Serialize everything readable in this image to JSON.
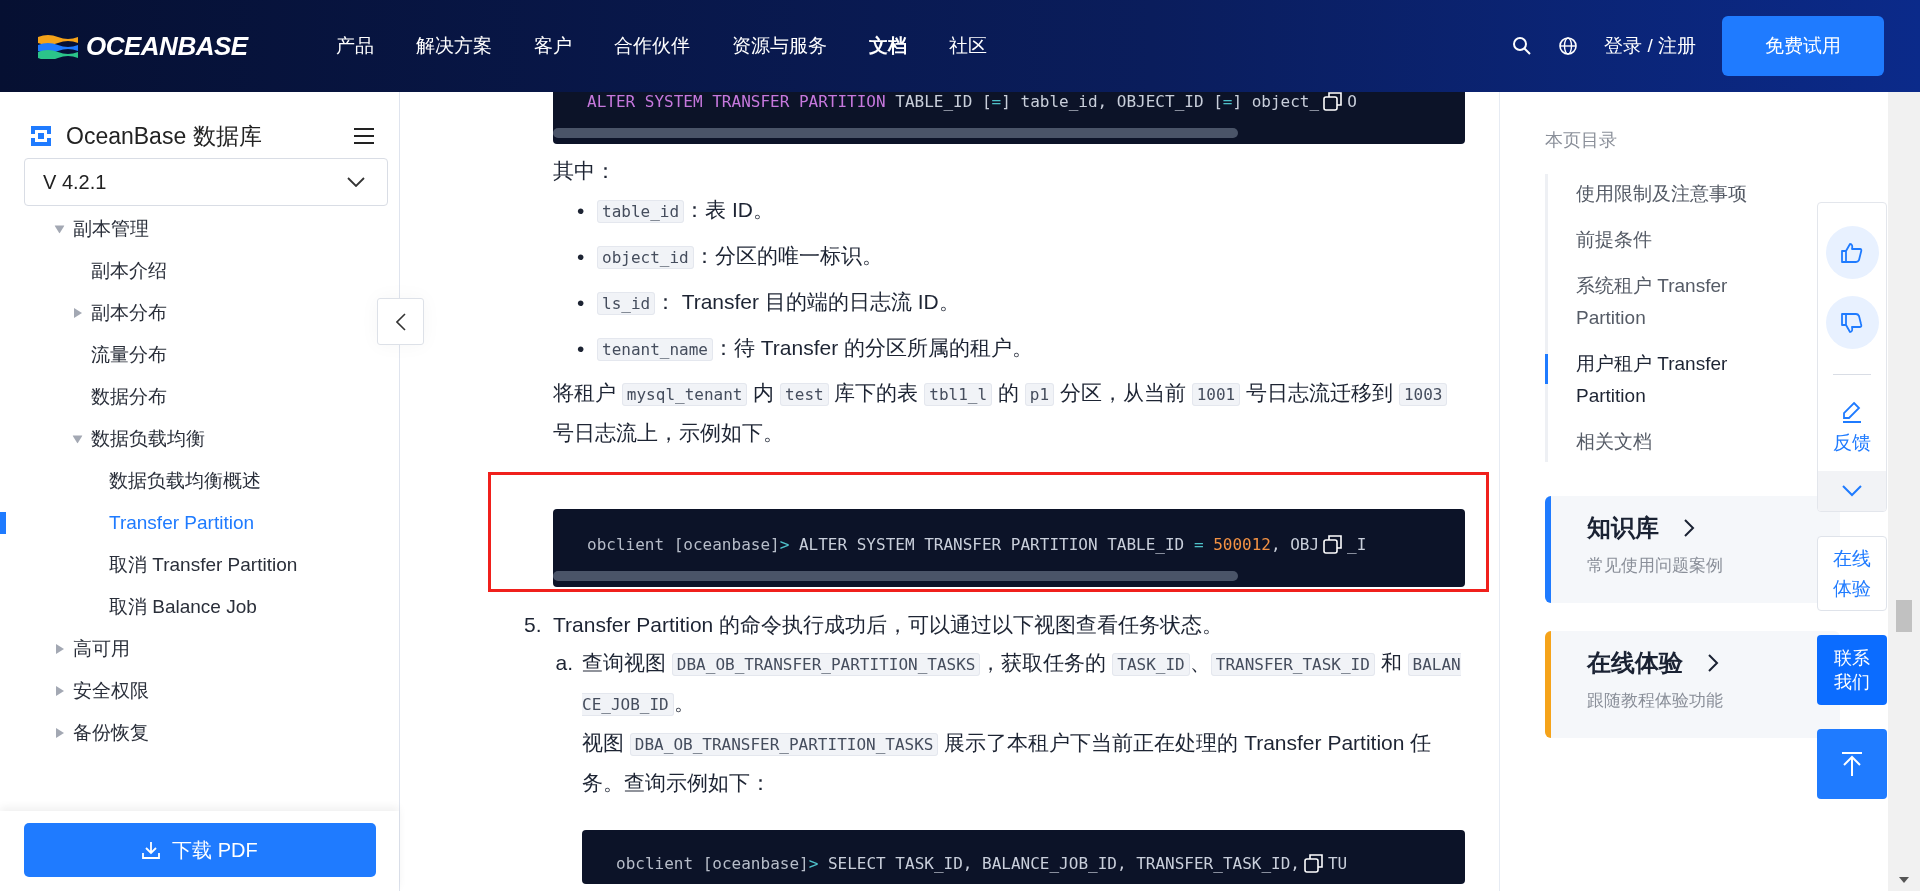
{
  "header": {
    "logo_text": "OCEANBASE",
    "nav": [
      {
        "label": "产品",
        "selected": false
      },
      {
        "label": "解决方案",
        "selected": false
      },
      {
        "label": "客户",
        "selected": false
      },
      {
        "label": "合作伙伴",
        "selected": false
      },
      {
        "label": "资源与服务",
        "selected": false
      },
      {
        "label": "文档",
        "selected": true
      },
      {
        "label": "社区",
        "selected": false
      }
    ],
    "login": "登录 / 注册",
    "cta": "免费试用"
  },
  "sidebar": {
    "title": "OceanBase 数据库",
    "version": "V 4.2.1",
    "download": "下载 PDF",
    "tree": [
      {
        "label": "副本管理",
        "kind": "folder",
        "expanded": true,
        "selected": false,
        "children": [
          {
            "label": "副本介绍",
            "kind": "leaf",
            "selected": false
          },
          {
            "label": "副本分布",
            "kind": "folder",
            "expanded": false,
            "selected": false
          },
          {
            "label": "流量分布",
            "kind": "leaf",
            "selected": false
          },
          {
            "label": "数据分布",
            "kind": "leaf",
            "selected": false
          },
          {
            "label": "数据负载均衡",
            "kind": "folder",
            "expanded": true,
            "selected": false,
            "children": [
              {
                "label": "数据负载均衡概述",
                "kind": "leaf",
                "selected": false
              },
              {
                "label": "Transfer Partition",
                "kind": "leaf",
                "selected": true
              },
              {
                "label": "取消 Transfer Partition",
                "kind": "leaf",
                "selected": false
              },
              {
                "label": "取消 Balance Job",
                "kind": "leaf",
                "selected": false
              }
            ]
          }
        ]
      },
      {
        "label": "高可用",
        "kind": "folder",
        "expanded": false,
        "selected": false
      },
      {
        "label": "安全权限",
        "kind": "folder",
        "expanded": false,
        "selected": false
      },
      {
        "label": "备份恢复",
        "kind": "folder",
        "expanded": false,
        "selected": false
      }
    ]
  },
  "content": [
    {
      "kind": "code",
      "highlighted": false,
      "tokens": [
        {
          "kind": "keyword",
          "s": "ALTER SYSTEM TRANSFER PARTITION"
        },
        {
          "kind": "plain",
          "s": " TABLE_ID ["
        },
        {
          "kind": "operator",
          "s": "="
        },
        {
          "kind": "plain",
          "s": "] table_id, OBJECT_ID ["
        },
        {
          "kind": "operator",
          "s": "="
        },
        {
          "kind": "plain",
          "s": "] object_"
        }
      ],
      "after": "O"
    },
    {
      "kind": "para",
      "segments": [
        {
          "kind": "text",
          "s": "其中："
        }
      ]
    },
    {
      "kind": "bullets",
      "items": [
        {
          "marker": "•",
          "segments": [
            {
              "kind": "code",
              "s": "table_id"
            },
            {
              "kind": "text",
              "s": "：表 ID。"
            }
          ]
        },
        {
          "marker": "•",
          "segments": [
            {
              "kind": "code",
              "s": "object_id"
            },
            {
              "kind": "text",
              "s": "：分区的唯一标识。"
            }
          ]
        },
        {
          "marker": "•",
          "segments": [
            {
              "kind": "code",
              "s": "ls_id"
            },
            {
              "kind": "text",
              "s": "： Transfer 目的端的日志流 ID。"
            }
          ]
        },
        {
          "marker": "•",
          "segments": [
            {
              "kind": "code",
              "s": "tenant_name"
            },
            {
              "kind": "text",
              "s": "：待 Transfer 的分区所属的租户。"
            }
          ]
        }
      ]
    },
    {
      "kind": "para",
      "segments": [
        {
          "kind": "text",
          "s": "将租户 "
        },
        {
          "kind": "code",
          "s": "mysql_tenant"
        },
        {
          "kind": "text",
          "s": " 内 "
        },
        {
          "kind": "code",
          "s": "test"
        },
        {
          "kind": "text",
          "s": " 库下的表 "
        },
        {
          "kind": "code",
          "s": "tbl1_l"
        },
        {
          "kind": "text",
          "s": " 的 "
        },
        {
          "kind": "code",
          "s": "p1"
        },
        {
          "kind": "text",
          "s": " 分区，从当前 "
        },
        {
          "kind": "code",
          "s": "1001"
        },
        {
          "kind": "text",
          "s": " 号日志流迁移到 "
        },
        {
          "kind": "code",
          "s": "1003"
        },
        {
          "kind": "text",
          "s": " 号日志流上，示例如下。"
        }
      ]
    },
    {
      "kind": "code",
      "highlighted": true,
      "tokens": [
        {
          "kind": "prompt",
          "s": "obclient [oceanbase]"
        },
        {
          "kind": "operator",
          "s": ">"
        },
        {
          "kind": "plain",
          "s": " ALTER SYSTEM TRANSFER PARTITION TABLE_ID "
        },
        {
          "kind": "operator",
          "s": "= "
        },
        {
          "kind": "number",
          "s": "500012"
        },
        {
          "kind": "plain",
          "s": ", OBJ"
        }
      ],
      "after": "_I"
    },
    {
      "kind": "step",
      "number": "5.",
      "segments": [
        {
          "kind": "text",
          "s": "Transfer Partition 的命令执行成功后，可以通过以下视图查看任务状态。"
        }
      ],
      "substeps": [
        {
          "number": "a.",
          "paragraphs": [
            [
              {
                "kind": "text",
                "s": "查询视图 "
              },
              {
                "kind": "code",
                "s": "DBA_OB_TRANSFER_PARTITION_TASKS"
              },
              {
                "kind": "text",
                "s": "，获取任务的 "
              },
              {
                "kind": "code",
                "s": "TASK_ID"
              },
              {
                "kind": "text",
                "s": "、"
              },
              {
                "kind": "code",
                "s": "TRANSFER_TASK_ID"
              },
              {
                "kind": "text",
                "s": " 和 "
              },
              {
                "kind": "code",
                "s": "BALANCE_JOB_ID"
              },
              {
                "kind": "text",
                "s": "。"
              }
            ],
            [
              {
                "kind": "text",
                "s": "视图 "
              },
              {
                "kind": "code",
                "s": "DBA_OB_TRANSFER_PARTITION_TASKS"
              },
              {
                "kind": "text",
                "s": " 展示了本租户下当前正在处理的 Transfer Partition 任务。查询示例如下："
              }
            ]
          ],
          "code": {
            "tokens": [
              {
                "kind": "prompt",
                "s": "obclient [oceanbase]"
              },
              {
                "kind": "operator",
                "s": ">"
              },
              {
                "kind": "plain",
                "s": " SELECT TASK_ID, BALANCE_JOB_ID, TRANSFER_TASK_ID,"
              }
            ],
            "after": "TU"
          }
        }
      ]
    }
  ],
  "toc": {
    "heading": "本页目录",
    "items": [
      {
        "label": "使用限制及注意事项",
        "selected": false
      },
      {
        "label": "前提条件",
        "selected": false
      },
      {
        "label": "系统租户 Transfer Partition",
        "selected": false
      },
      {
        "label": "用户租户 Transfer Partition",
        "selected": true
      },
      {
        "label": "相关文档",
        "selected": false
      }
    ]
  },
  "cards": [
    {
      "title": "知识库",
      "subtitle": "常见使用问题案例",
      "color": "#1f7bff"
    },
    {
      "title": "在线体验",
      "subtitle": "跟随教程体验功能",
      "color": "#f5a31a"
    }
  ],
  "float": {
    "feedback": "反馈",
    "try": "在线体验",
    "contact": "联系我们"
  }
}
